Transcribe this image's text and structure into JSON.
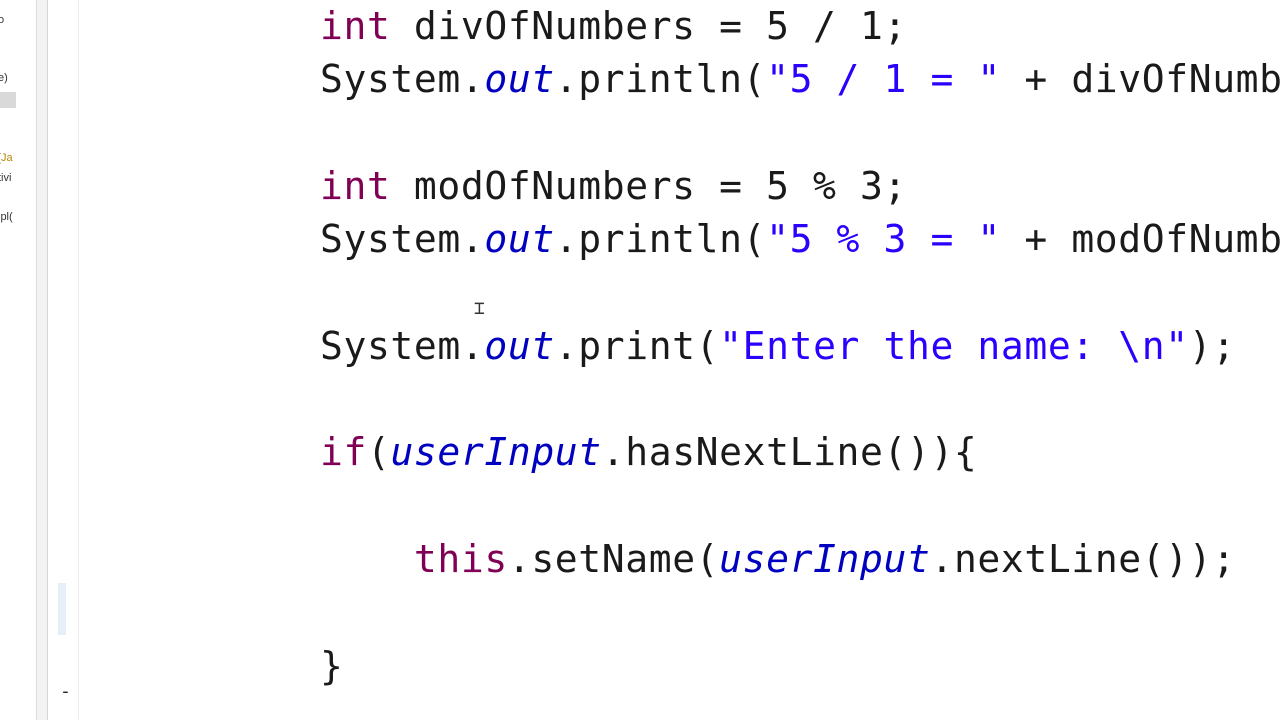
{
  "explorer": {
    "items": [
      {
        "label": "o"
      },
      {
        "label": "e)"
      },
      {
        "label": ""
      },
      {
        "label": "[Ja"
      },
      {
        "label": "tivi"
      },
      {
        "label": "ipl("
      }
    ]
  },
  "editor": {
    "lines": [
      {
        "indent": "",
        "tokens": [
          {
            "t": "int",
            "c": "kw"
          },
          {
            "t": " divOfNumbers = 5 / 1;",
            "c": "plain"
          }
        ]
      },
      {
        "indent": "",
        "tokens": [
          {
            "t": "System.",
            "c": "plain"
          },
          {
            "t": "out",
            "c": "field"
          },
          {
            "t": ".println(",
            "c": "plain"
          },
          {
            "t": "\"5 / 1 = \"",
            "c": "str"
          },
          {
            "t": " + divOfNumber",
            "c": "plain"
          }
        ]
      },
      {
        "indent": "",
        "tokens": []
      },
      {
        "indent": "",
        "tokens": [
          {
            "t": "int",
            "c": "kw"
          },
          {
            "t": " modOfNumbers = 5 % 3;",
            "c": "plain"
          }
        ]
      },
      {
        "indent": "",
        "tokens": [
          {
            "t": "System.",
            "c": "plain"
          },
          {
            "t": "out",
            "c": "field"
          },
          {
            "t": ".println(",
            "c": "plain"
          },
          {
            "t": "\"5 % 3 = \"",
            "c": "str"
          },
          {
            "t": " + modOfNumber",
            "c": "plain"
          }
        ]
      },
      {
        "indent": "",
        "tokens": []
      },
      {
        "indent": "",
        "tokens": [
          {
            "t": "System.",
            "c": "plain"
          },
          {
            "t": "out",
            "c": "field"
          },
          {
            "t": ".print(",
            "c": "plain"
          },
          {
            "t": "\"Enter the name: \\n\"",
            "c": "str"
          },
          {
            "t": ");",
            "c": "plain"
          }
        ]
      },
      {
        "indent": "",
        "tokens": []
      },
      {
        "indent": "",
        "tokens": [
          {
            "t": "if",
            "c": "kw"
          },
          {
            "t": "(",
            "c": "plain"
          },
          {
            "t": "userInput",
            "c": "ivar"
          },
          {
            "t": ".hasNextLine()){",
            "c": "plain"
          }
        ]
      },
      {
        "indent": "",
        "tokens": []
      },
      {
        "indent": "    ",
        "tokens": [
          {
            "t": "this",
            "c": "kw"
          },
          {
            "t": ".setName(",
            "c": "plain"
          },
          {
            "t": "userInput",
            "c": "ivar"
          },
          {
            "t": ".nextLine());",
            "c": "plain"
          }
        ]
      },
      {
        "indent": "",
        "tokens": []
      },
      {
        "indent": "",
        "tokens": [
          {
            "t": "}",
            "c": "plain"
          }
        ]
      }
    ]
  },
  "ruler": {
    "dash": "-"
  },
  "colors": {
    "keyword": "#7f0055",
    "string": "#2a00ff",
    "field": "#0000c0"
  }
}
